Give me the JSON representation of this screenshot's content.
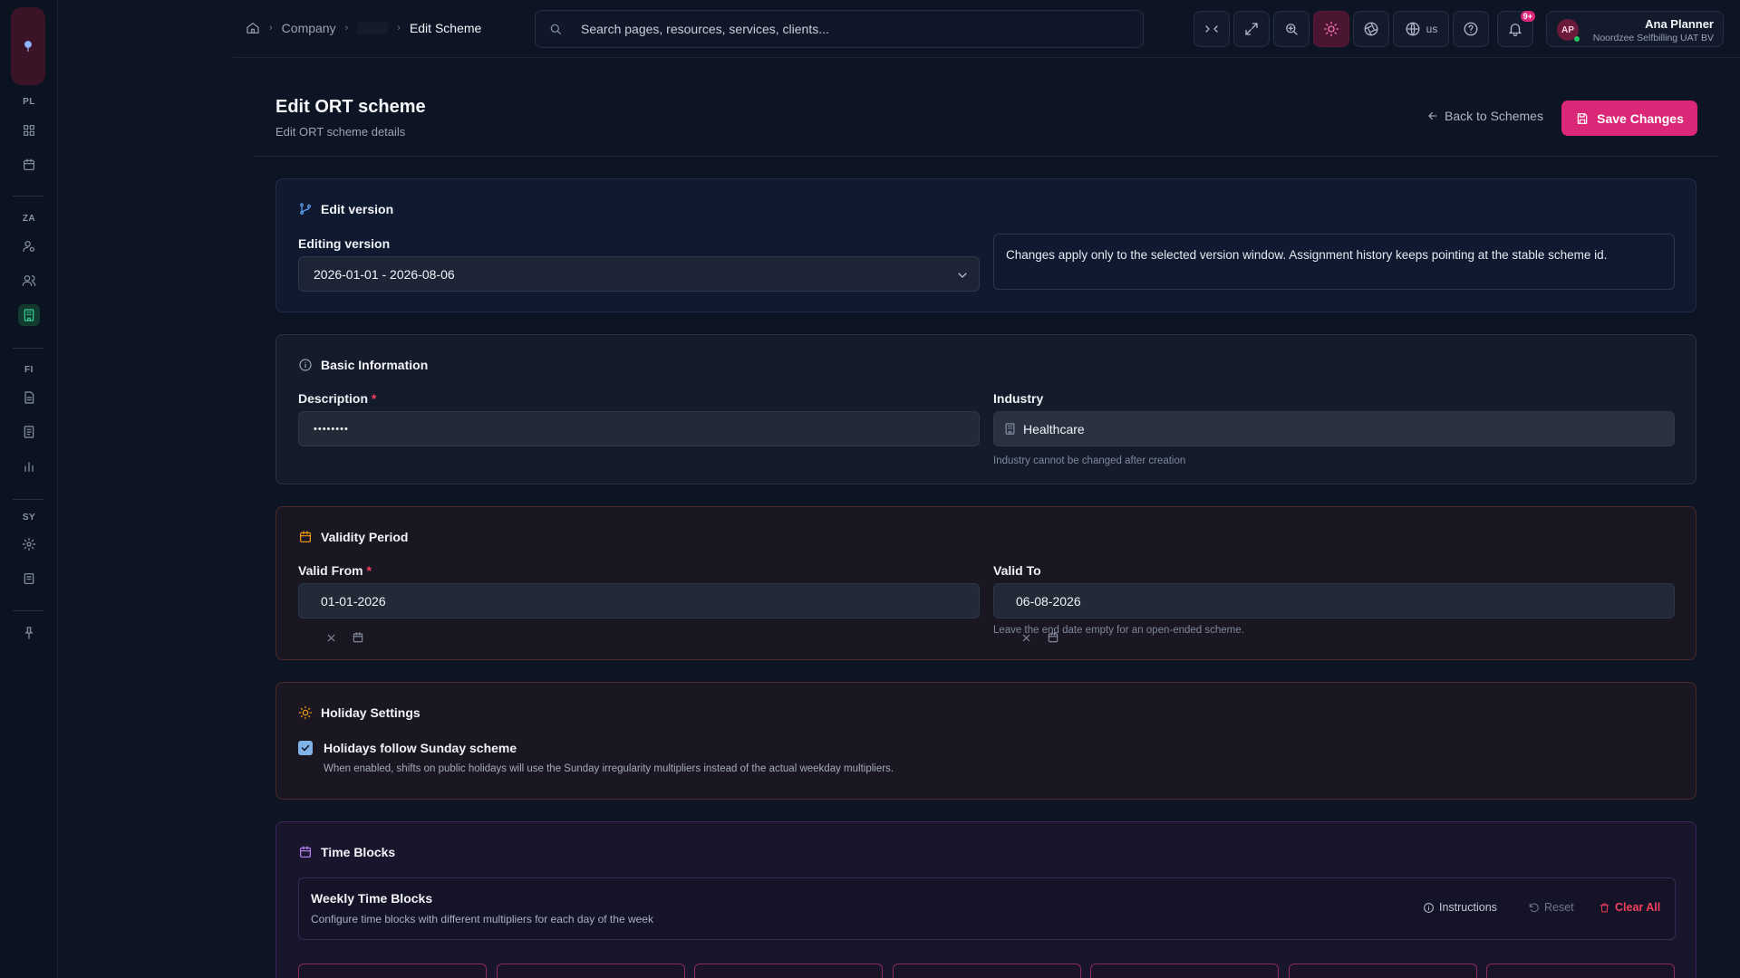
{
  "rail": {
    "sections": [
      {
        "code": "PL"
      },
      {
        "code": "ZA"
      },
      {
        "code": "FI"
      },
      {
        "code": "SY"
      }
    ]
  },
  "breadcrumb": {
    "company": "Company",
    "current": "Edit Scheme"
  },
  "search": {
    "placeholder": "Search pages, resources, services, clients..."
  },
  "toolbar": {
    "language": "us",
    "notifications_badge": "9+"
  },
  "user": {
    "initials": "AP",
    "name": "Ana Planner",
    "org": "Noordzee Selfbilling UAT BV"
  },
  "page": {
    "title": "Edit ORT scheme",
    "subtitle": "Edit ORT scheme details",
    "back_label": "Back to Schemes",
    "save_label": "Save Changes"
  },
  "edit_version": {
    "heading": "Edit version",
    "field_label": "Editing version",
    "selected": "2026-01-01 - 2026-08-06",
    "info": "Changes apply only to the selected version window. Assignment history keeps pointing at the stable scheme id."
  },
  "basic": {
    "heading": "Basic Information",
    "description_label": "Description",
    "required_mark": "*",
    "description_value": "••••••••",
    "industry_label": "Industry",
    "industry_value": "Healthcare",
    "industry_note": "Industry cannot be changed after creation"
  },
  "validity": {
    "heading": "Validity Period",
    "from_label": "Valid From",
    "from_value": "01-01-2026",
    "to_label": "Valid To",
    "to_value": "06-08-2026",
    "to_note": "Leave the end date empty for an open-ended scheme."
  },
  "holiday": {
    "heading": "Holiday Settings",
    "checkbox_label": "Holidays follow Sunday scheme",
    "checked": true,
    "description": "When enabled, shifts on public holidays will use the Sunday irregularity multipliers instead of the actual weekday multipliers."
  },
  "time_blocks": {
    "heading": "Time Blocks",
    "panel_title": "Weekly Time Blocks",
    "panel_subtitle": "Configure time blocks with different multipliers for each day of the week",
    "instructions_label": "Instructions",
    "reset_label": "Reset",
    "clear_label": "Clear All"
  },
  "colors": {
    "accent": "#db2777",
    "active_nav": "#34d399",
    "danger": "#f43f5e"
  }
}
